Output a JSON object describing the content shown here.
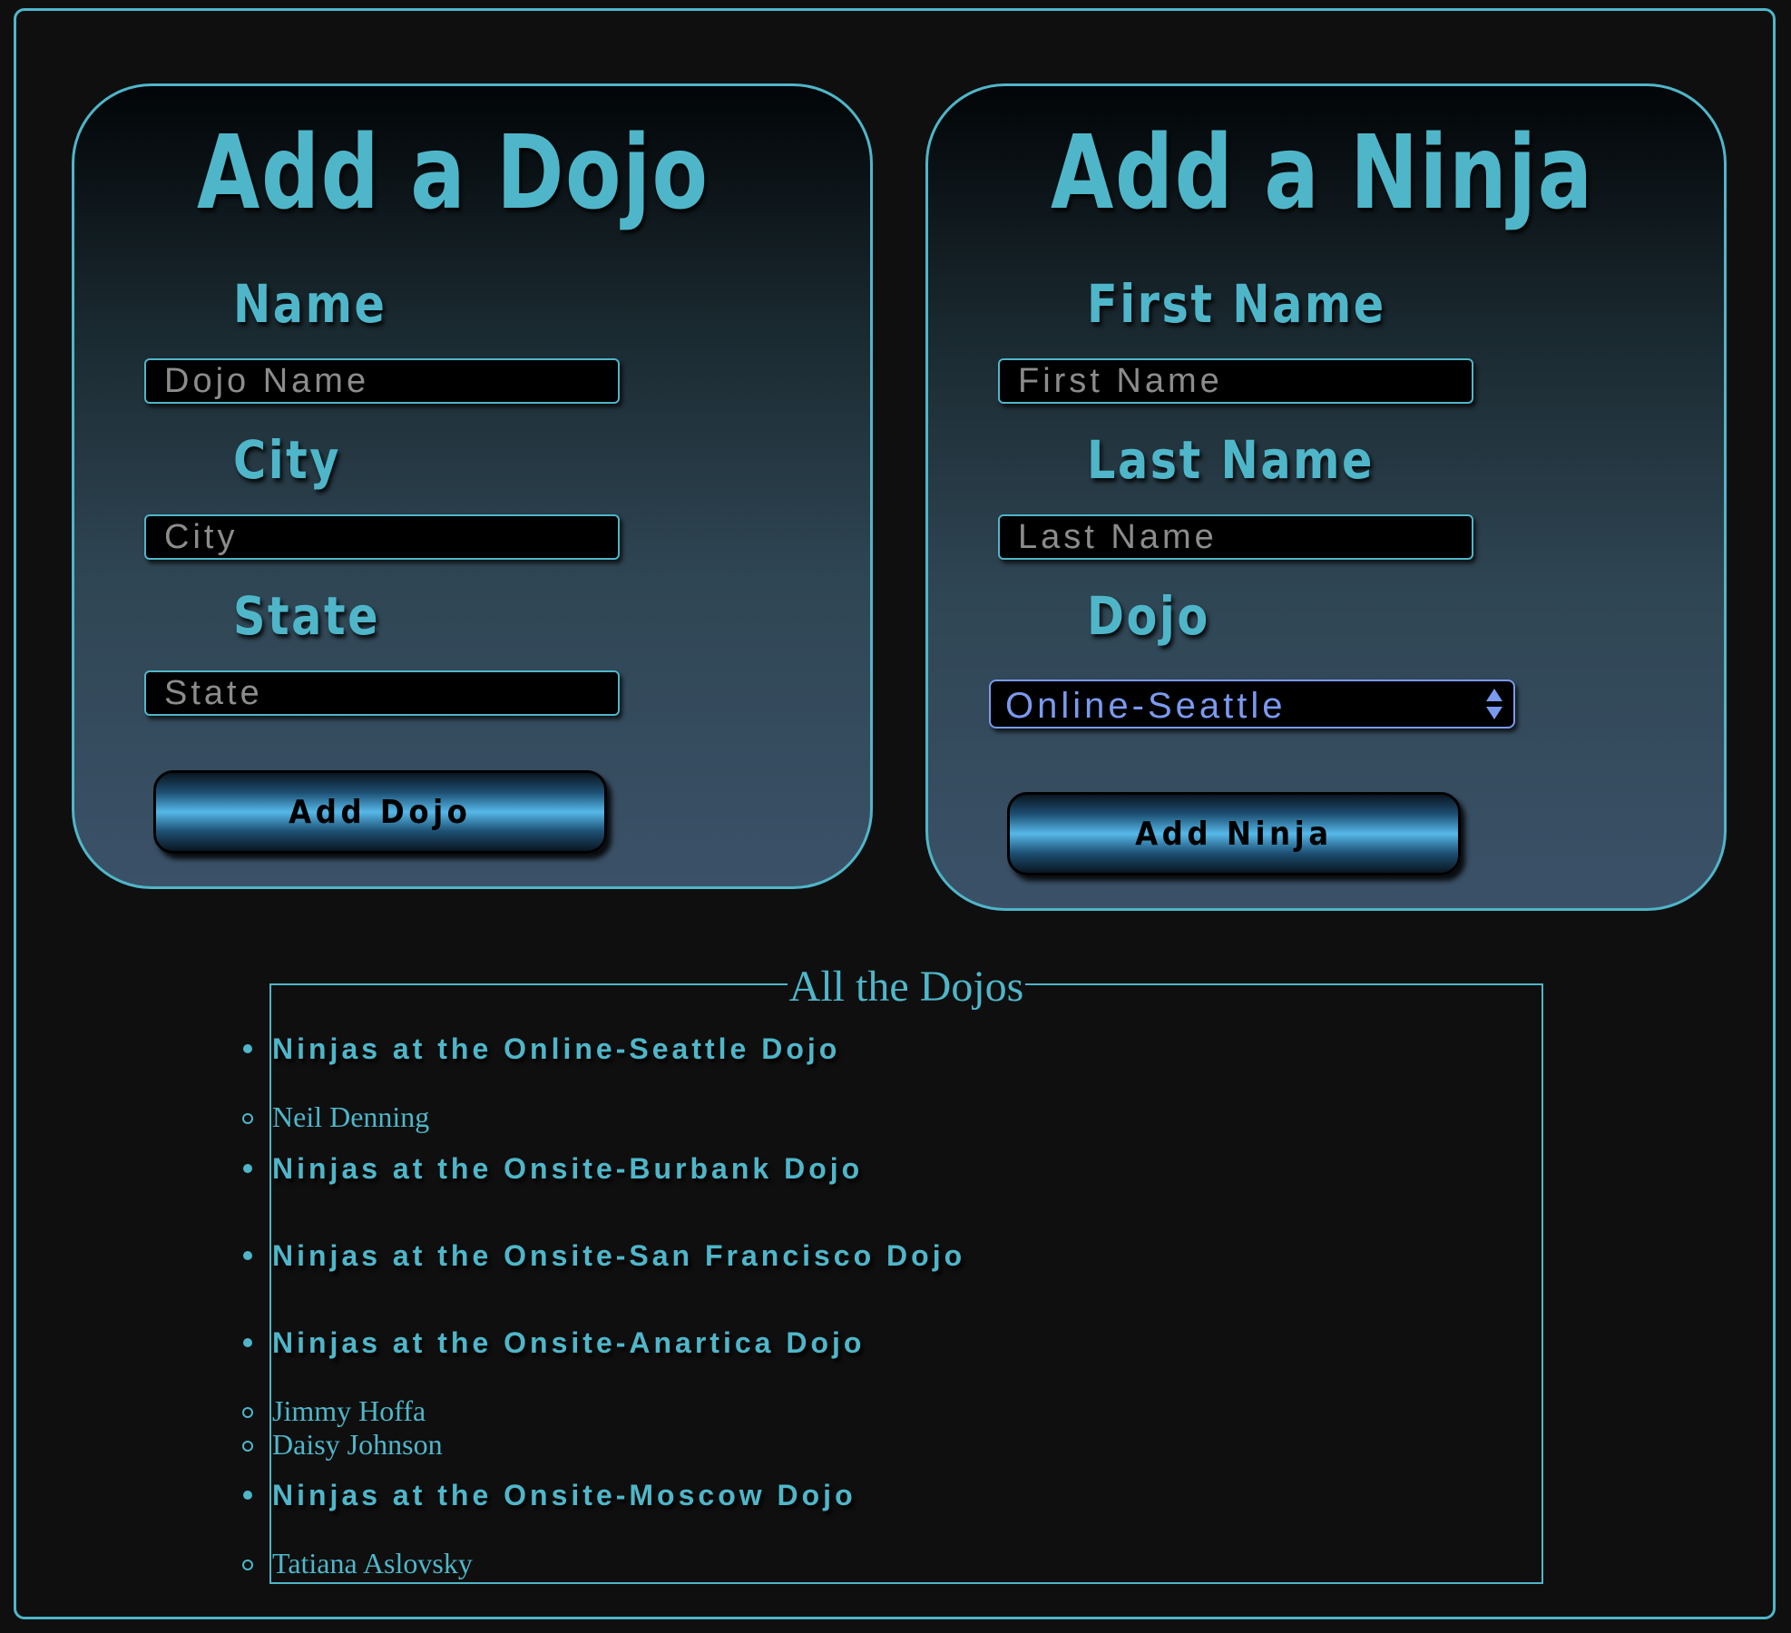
{
  "dojo_form": {
    "title": "Add a Dojo",
    "name_label": "Name",
    "name_placeholder": "Dojo Name",
    "city_label": "City",
    "city_placeholder": "City",
    "state_label": "State",
    "state_placeholder": "State",
    "submit_label": "Add Dojo"
  },
  "ninja_form": {
    "title": "Add a Ninja",
    "first_name_label": "First Name",
    "first_name_placeholder": "First Name",
    "last_name_label": "Last Name",
    "last_name_placeholder": "Last Name",
    "dojo_label": "Dojo",
    "dojo_selected": "Online-Seattle",
    "submit_label": "Add Ninja"
  },
  "dojo_list": {
    "legend": "All the Dojos",
    "dojos": [
      {
        "heading": "Ninjas at the Online-Seattle Dojo",
        "ninjas": [
          "Neil Denning"
        ]
      },
      {
        "heading": "Ninjas at the Onsite-Burbank Dojo",
        "ninjas": []
      },
      {
        "heading": "Ninjas at the Onsite-San Francisco Dojo",
        "ninjas": []
      },
      {
        "heading": "Ninjas at the Onsite-Anartica Dojo",
        "ninjas": [
          "Jimmy Hoffa",
          "Daisy Johnson"
        ]
      },
      {
        "heading": "Ninjas at the Onsite-Moscow Dojo",
        "ninjas": [
          "Tatiana Aslovsky"
        ]
      }
    ]
  },
  "colors": {
    "accent": "#4fb6c9",
    "select_text": "#7a9af0",
    "background": "#0f0f0f",
    "button_glow": "#56b8e8"
  }
}
